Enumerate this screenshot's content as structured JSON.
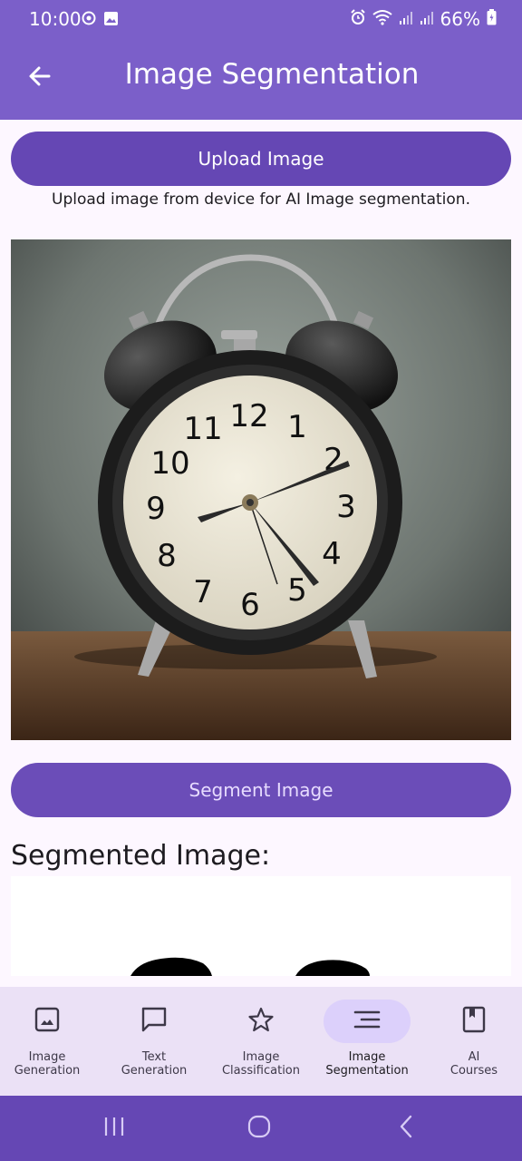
{
  "status_bar": {
    "time": "10:00",
    "battery": "66%",
    "left_icons": [
      "notification-icon",
      "gallery-icon"
    ],
    "right_icons": [
      "alarm-icon",
      "wifi-icon",
      "signal-icon",
      "signal-icon",
      "battery-icon"
    ]
  },
  "app_bar": {
    "title": "Image Segmentation",
    "back_icon": "arrow-back-icon"
  },
  "upload": {
    "button_label": "Upload Image",
    "hint": "Upload image from device for AI Image segmentation."
  },
  "photo": {
    "subject": "alarm-clock"
  },
  "segment": {
    "button_label": "Segment Image"
  },
  "result": {
    "title": "Segmented Image:"
  },
  "bottom_nav": {
    "items": [
      {
        "label": "Image\nGeneration",
        "icon": "image-icon",
        "active": false
      },
      {
        "label": "Text\nGeneration",
        "icon": "message-icon",
        "active": false
      },
      {
        "label": "Image\nClassification",
        "icon": "star-icon",
        "active": false
      },
      {
        "label": "Image\nSegmentation",
        "icon": "segment-lines-icon",
        "active": true
      },
      {
        "label": "AI\nCourses",
        "icon": "book-icon",
        "active": false
      }
    ]
  },
  "system_nav": {
    "buttons": [
      "recents-button",
      "home-button",
      "back-button"
    ]
  },
  "colors": {
    "primary": "#7b5fc9",
    "button": "#6547b4",
    "nav_bg": "#ebe1f6",
    "active_pill": "#dcd0fb"
  }
}
